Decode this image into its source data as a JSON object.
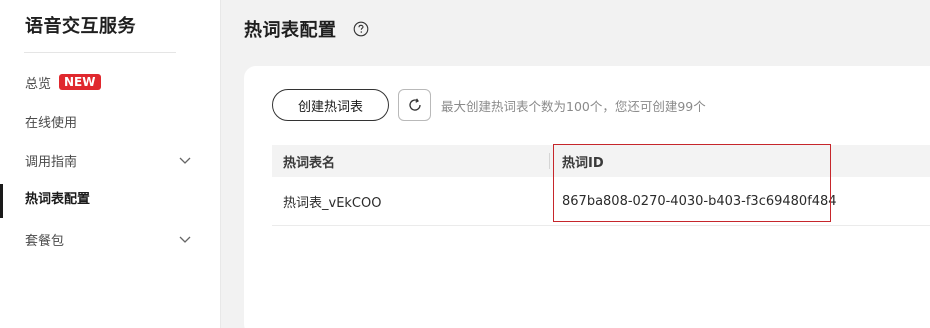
{
  "sidebar": {
    "title": "语音交互服务",
    "items": [
      {
        "label": "总览",
        "badge": "NEW"
      },
      {
        "label": "在线使用"
      },
      {
        "label": "调用指南",
        "expandable": true
      },
      {
        "label": "热词表配置",
        "active": true
      },
      {
        "label": "套餐包",
        "expandable": true
      }
    ]
  },
  "page": {
    "title": "热词表配置",
    "help_icon": "question-circle-icon"
  },
  "toolbar": {
    "create_label": "创建热词表",
    "refresh_icon": "refresh-icon",
    "hint": "最大创建热词表个数为100个，您还可创建99个"
  },
  "table": {
    "columns": [
      "热词表名",
      "热词ID"
    ],
    "rows": [
      {
        "name": "热词表_vEkCOO",
        "id": "867ba808-0270-4030-b403-f3c69480f484"
      }
    ]
  },
  "colors": {
    "badge": "#e0282e",
    "highlight": "#c6262b",
    "main_bg": "#f2f2f2"
  }
}
